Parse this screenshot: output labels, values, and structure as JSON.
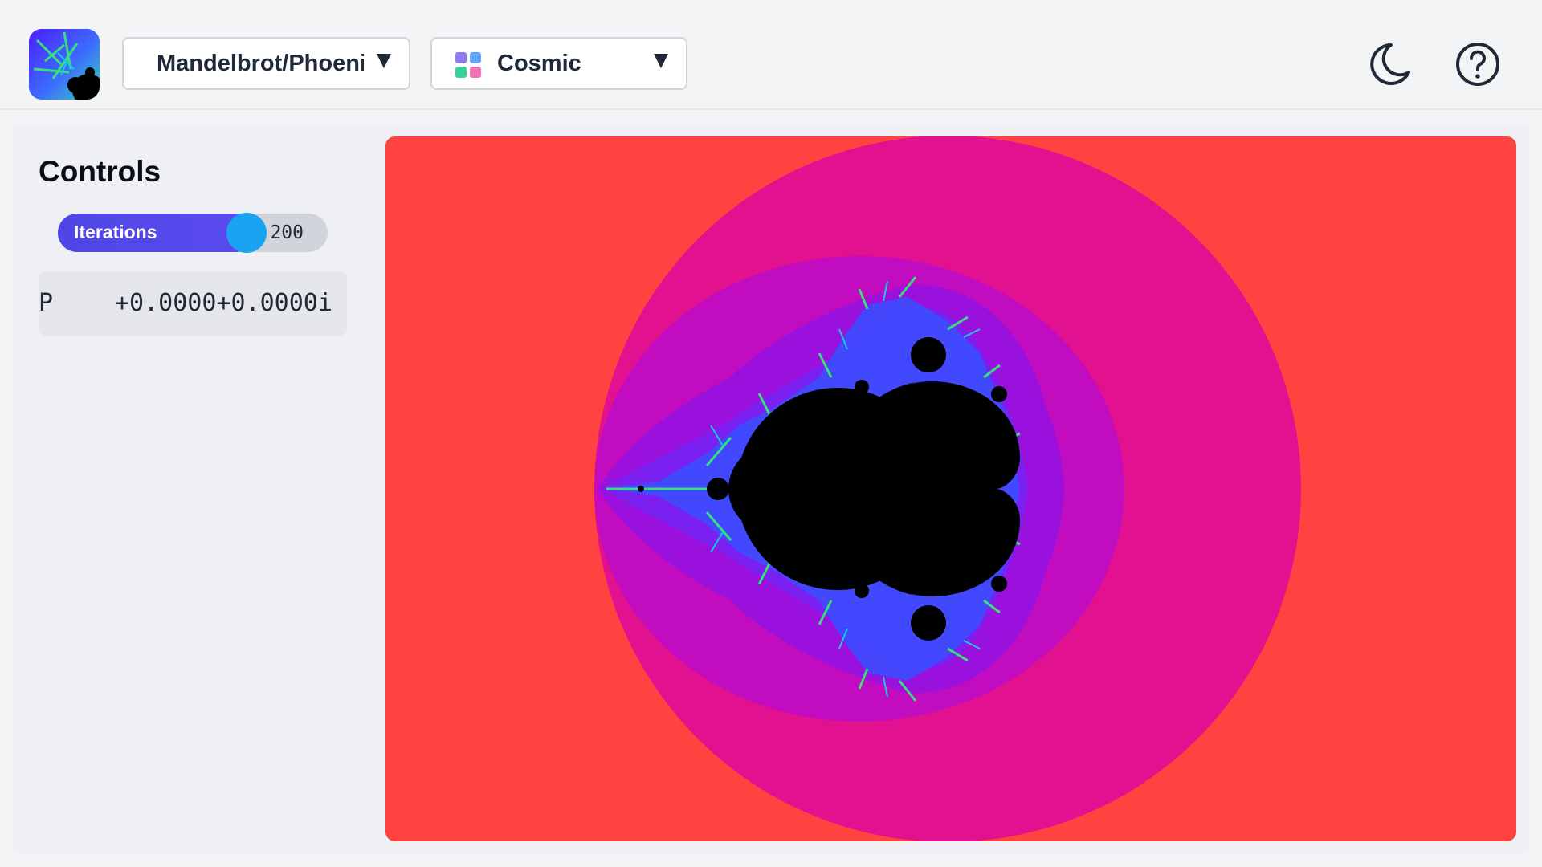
{
  "header": {
    "logo_icon": "mandelbrot-logo-icon",
    "fractal_select": {
      "value": "Mandelbrot/Phoenix",
      "icon": "chevron-down-icon"
    },
    "palette_select": {
      "value": "Cosmic",
      "icon": "palette-grid-icon",
      "swatch_colors": [
        "#8b7cf6",
        "#60a5fa",
        "#34d399",
        "#f472b6"
      ]
    },
    "theme_toggle_icon": "moon-icon",
    "help_icon": "help-circle-icon"
  },
  "controls": {
    "title": "Controls",
    "iterations": {
      "label": "Iterations",
      "value": "200",
      "fill_fraction": 0.7
    },
    "parameter": {
      "name": "P",
      "value": "+0.0000+0.0000i"
    }
  },
  "canvas": {
    "fractal": "Mandelbrot",
    "palette_colors": {
      "outer": "#ff4340",
      "band1": "#e2118f",
      "band2": "#c10cc0",
      "band3": "#9a10dd",
      "band4": "#7a20f0",
      "edge_blue": "#3c4cff",
      "edge_cyan": "#18c9e6",
      "edge_green": "#36e07a",
      "set": "#000000"
    }
  }
}
